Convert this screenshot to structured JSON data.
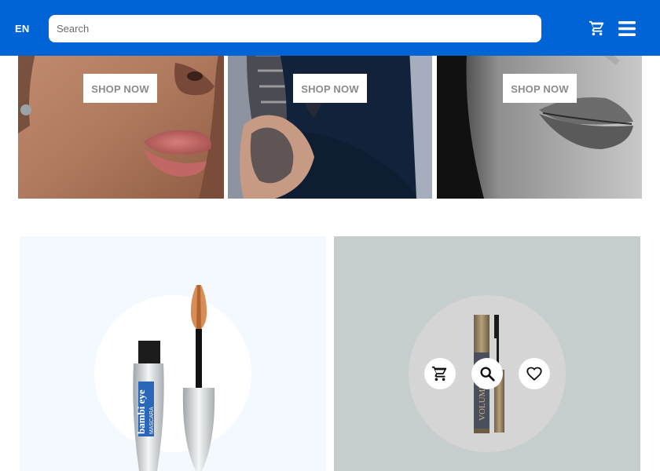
{
  "header": {
    "language": "EN",
    "search_placeholder": "Search",
    "cart_icon": "cart-icon",
    "menu_icon": "menu-icon"
  },
  "banners": [
    {
      "cta": "SHOP NOW"
    },
    {
      "cta": "SHOP NOW"
    },
    {
      "cta": "SHOP NOW"
    }
  ],
  "products": [
    {
      "brand_text": "bambi eye",
      "sub_text": "MASCARA"
    },
    {
      "brand_text": "VOLUME",
      "actions": [
        "cart-icon",
        "search-icon",
        "heart-icon"
      ]
    }
  ],
  "colors": {
    "header_bg": "#0063d6",
    "product1_bg": "#f3f9fe",
    "product2_bg": "#c6cdcd"
  }
}
